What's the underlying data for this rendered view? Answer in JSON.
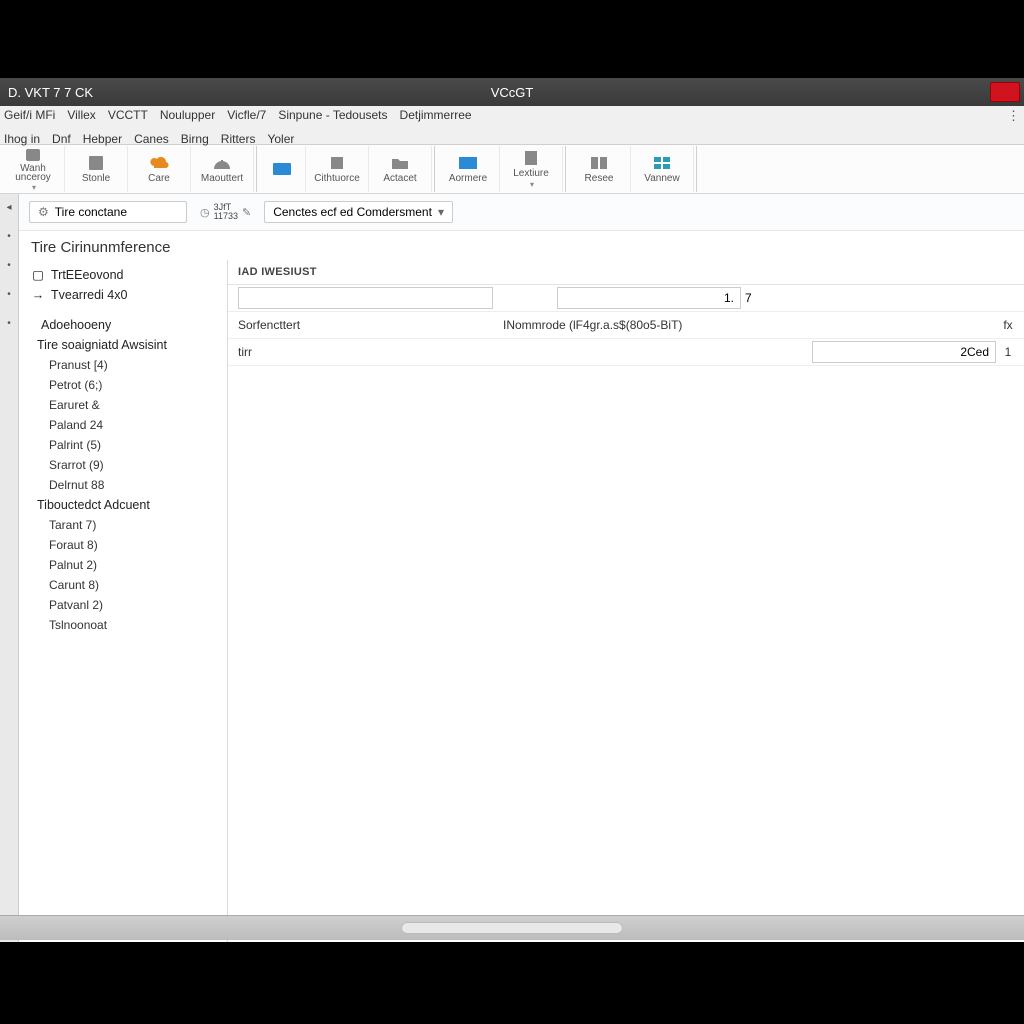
{
  "titlebar": {
    "left": "D. VKT 7  7 CK",
    "center": "VCcGT"
  },
  "menubar": {
    "row1": [
      "Geif/i  MFi",
      "Villex",
      "VCCTT",
      "Noulupper",
      "Vicfle/7",
      "Sinpune - Tedousets",
      "Detjimmerree"
    ],
    "row2": [
      "Ihog   in",
      "Dnf",
      "Hebper",
      "Canes",
      "Birng",
      "Ritters",
      "Yoler"
    ]
  },
  "ribbon": [
    {
      "label": "Wanh\nunceroy"
    },
    {
      "label": "Stonle"
    },
    {
      "label": "Care"
    },
    {
      "label": "Maouttert"
    },
    {
      "label": ""
    },
    {
      "label": "Cithtuorce"
    },
    {
      "label": "Actacet"
    },
    {
      "label": "Aormere"
    },
    {
      "label": "Lextiure"
    },
    {
      "label": "Resee"
    },
    {
      "label": "Vannew"
    }
  ],
  "subtoolbar": {
    "breadcrumb": "Tire conctane",
    "mini_value": "3JfT\n11733",
    "dropdown": "Cenctes ecf ed Comdersment"
  },
  "section_title": "Tire Cirinunmference",
  "tree": {
    "top": [
      {
        "icon": "doc",
        "label": "TrtEEeovond"
      },
      {
        "icon": "arrow",
        "label": "Tvearredi 4x0"
      }
    ],
    "groups": [
      {
        "head": "Adoehooeny",
        "subhead": "Tire soaigniatd Awsisint",
        "children": [
          "Pranust [4)",
          "Petrot (6;)",
          "Earuret &",
          "Paland 24",
          "Palrint (5)",
          "Srarrot (9)",
          "Delrnut 88"
        ]
      },
      {
        "head": "Tibouctedct Adcuent",
        "children": [
          "Tarant 7)",
          "Foraut 8)",
          "Palnut 2)",
          "Carunt 8)",
          "Patvanl 2)",
          "Tslnoonoat"
        ]
      }
    ]
  },
  "form": {
    "header": "IAD IWESIUST",
    "rows": [
      {
        "left_input": "",
        "right_input": "1.",
        "right_suffix": "7"
      },
      {
        "left_label": "Sorfencttert",
        "right_label": "INommrode (lF4gr.a.s$(80o5-BiT)",
        "right_suffix": "fx"
      },
      {
        "left_label": "tirr",
        "right_input": "2Ced",
        "right_suffix": "1"
      }
    ]
  }
}
